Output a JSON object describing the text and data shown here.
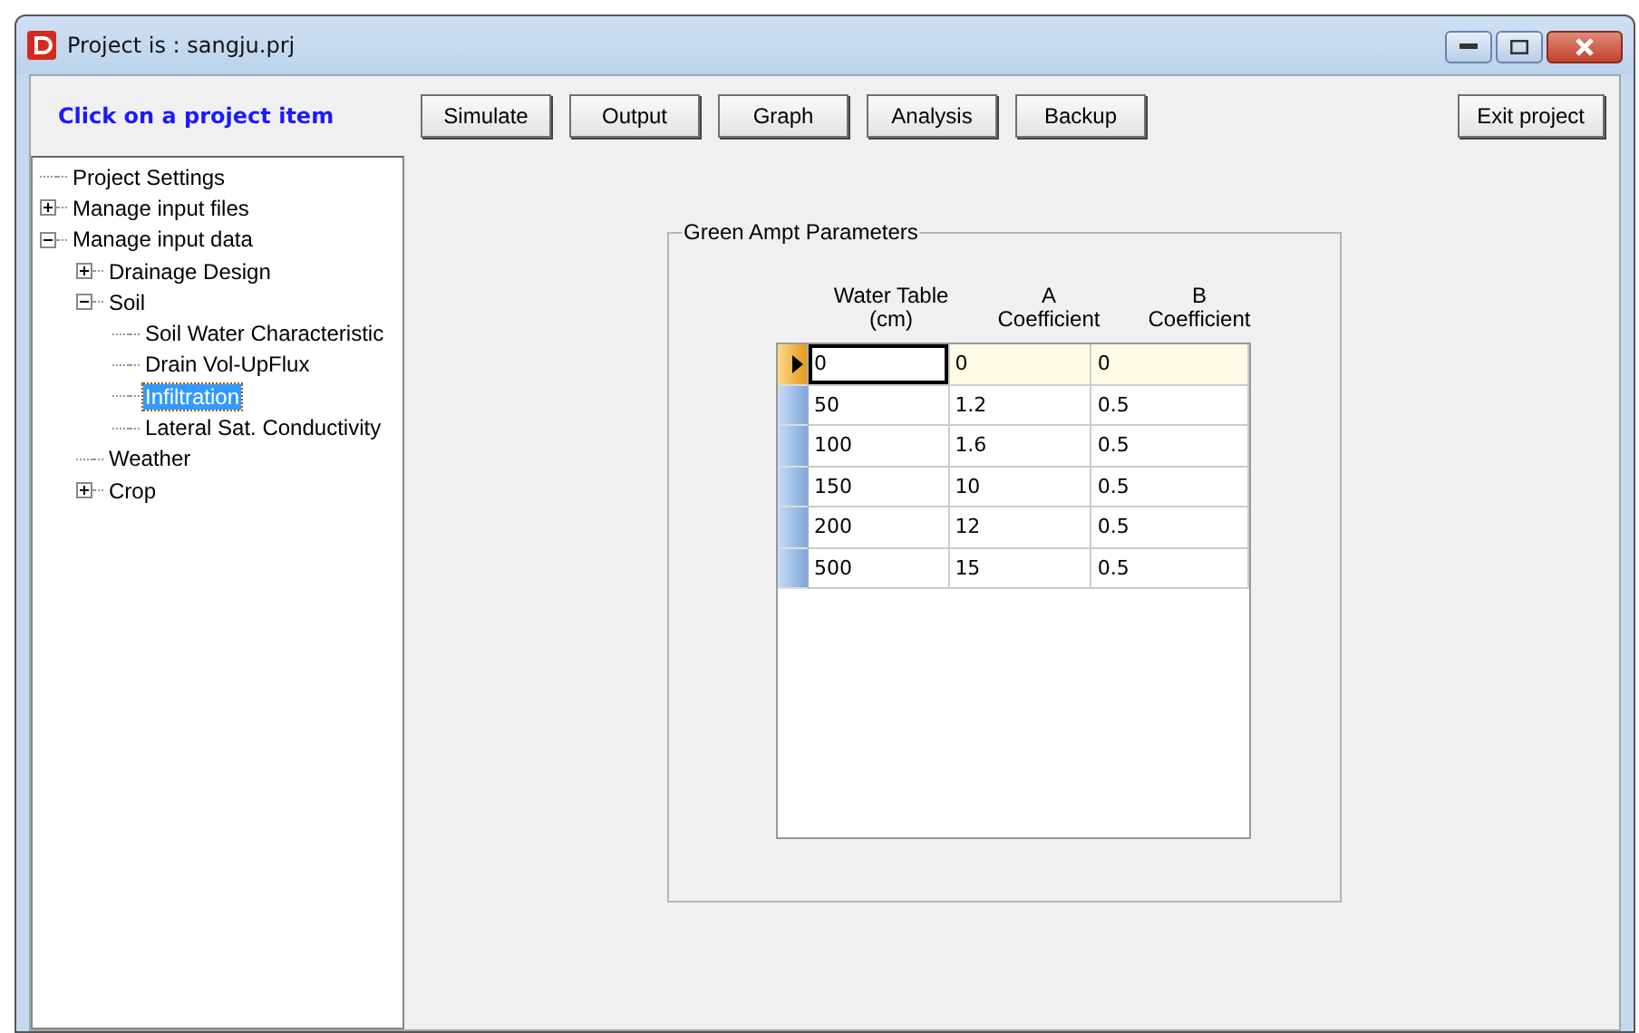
{
  "window": {
    "title": "Project is : sangju.prj"
  },
  "prompt": "Click on a project item",
  "toolbar": [
    "Simulate",
    "Output",
    "Graph",
    "Analysis",
    "Backup"
  ],
  "exit_button": "Exit project",
  "tree": [
    {
      "label": "Project Settings",
      "selected": false
    },
    {
      "label": "Manage input files",
      "selected": false,
      "expanded": false
    },
    {
      "label": "Manage input data",
      "selected": false,
      "expanded": true,
      "children": [
        {
          "label": "Drainage Design",
          "selected": false,
          "expanded": false
        },
        {
          "label": "Soil",
          "selected": false,
          "expanded": true,
          "children": [
            {
              "label": "Soil Water Characteristic",
              "selected": false
            },
            {
              "label": "Drain Vol-UpFlux",
              "selected": false
            },
            {
              "label": "Infiltration",
              "selected": true
            },
            {
              "label": "Lateral Sat. Conductivity",
              "selected": false
            }
          ]
        },
        {
          "label": "Weather",
          "selected": false
        },
        {
          "label": "Crop",
          "selected": false,
          "expanded": false
        }
      ]
    }
  ],
  "group": {
    "title": "Green Ampt Parameters",
    "columns": [
      "Water Table\n(cm)",
      "A\nCoefficient",
      "B\nCoefficient"
    ],
    "rows": [
      {
        "cells": [
          "0",
          "0",
          "0"
        ],
        "selected": true
      },
      {
        "cells": [
          "50",
          "1.2",
          "0.5"
        ],
        "selected": false
      },
      {
        "cells": [
          "100",
          "1.6",
          "0.5"
        ],
        "selected": false
      },
      {
        "cells": [
          "150",
          "10",
          "0.5"
        ],
        "selected": false
      },
      {
        "cells": [
          "200",
          "12",
          "0.5"
        ],
        "selected": false
      },
      {
        "cells": [
          "500",
          "15",
          "0.5"
        ],
        "selected": false
      }
    ]
  }
}
